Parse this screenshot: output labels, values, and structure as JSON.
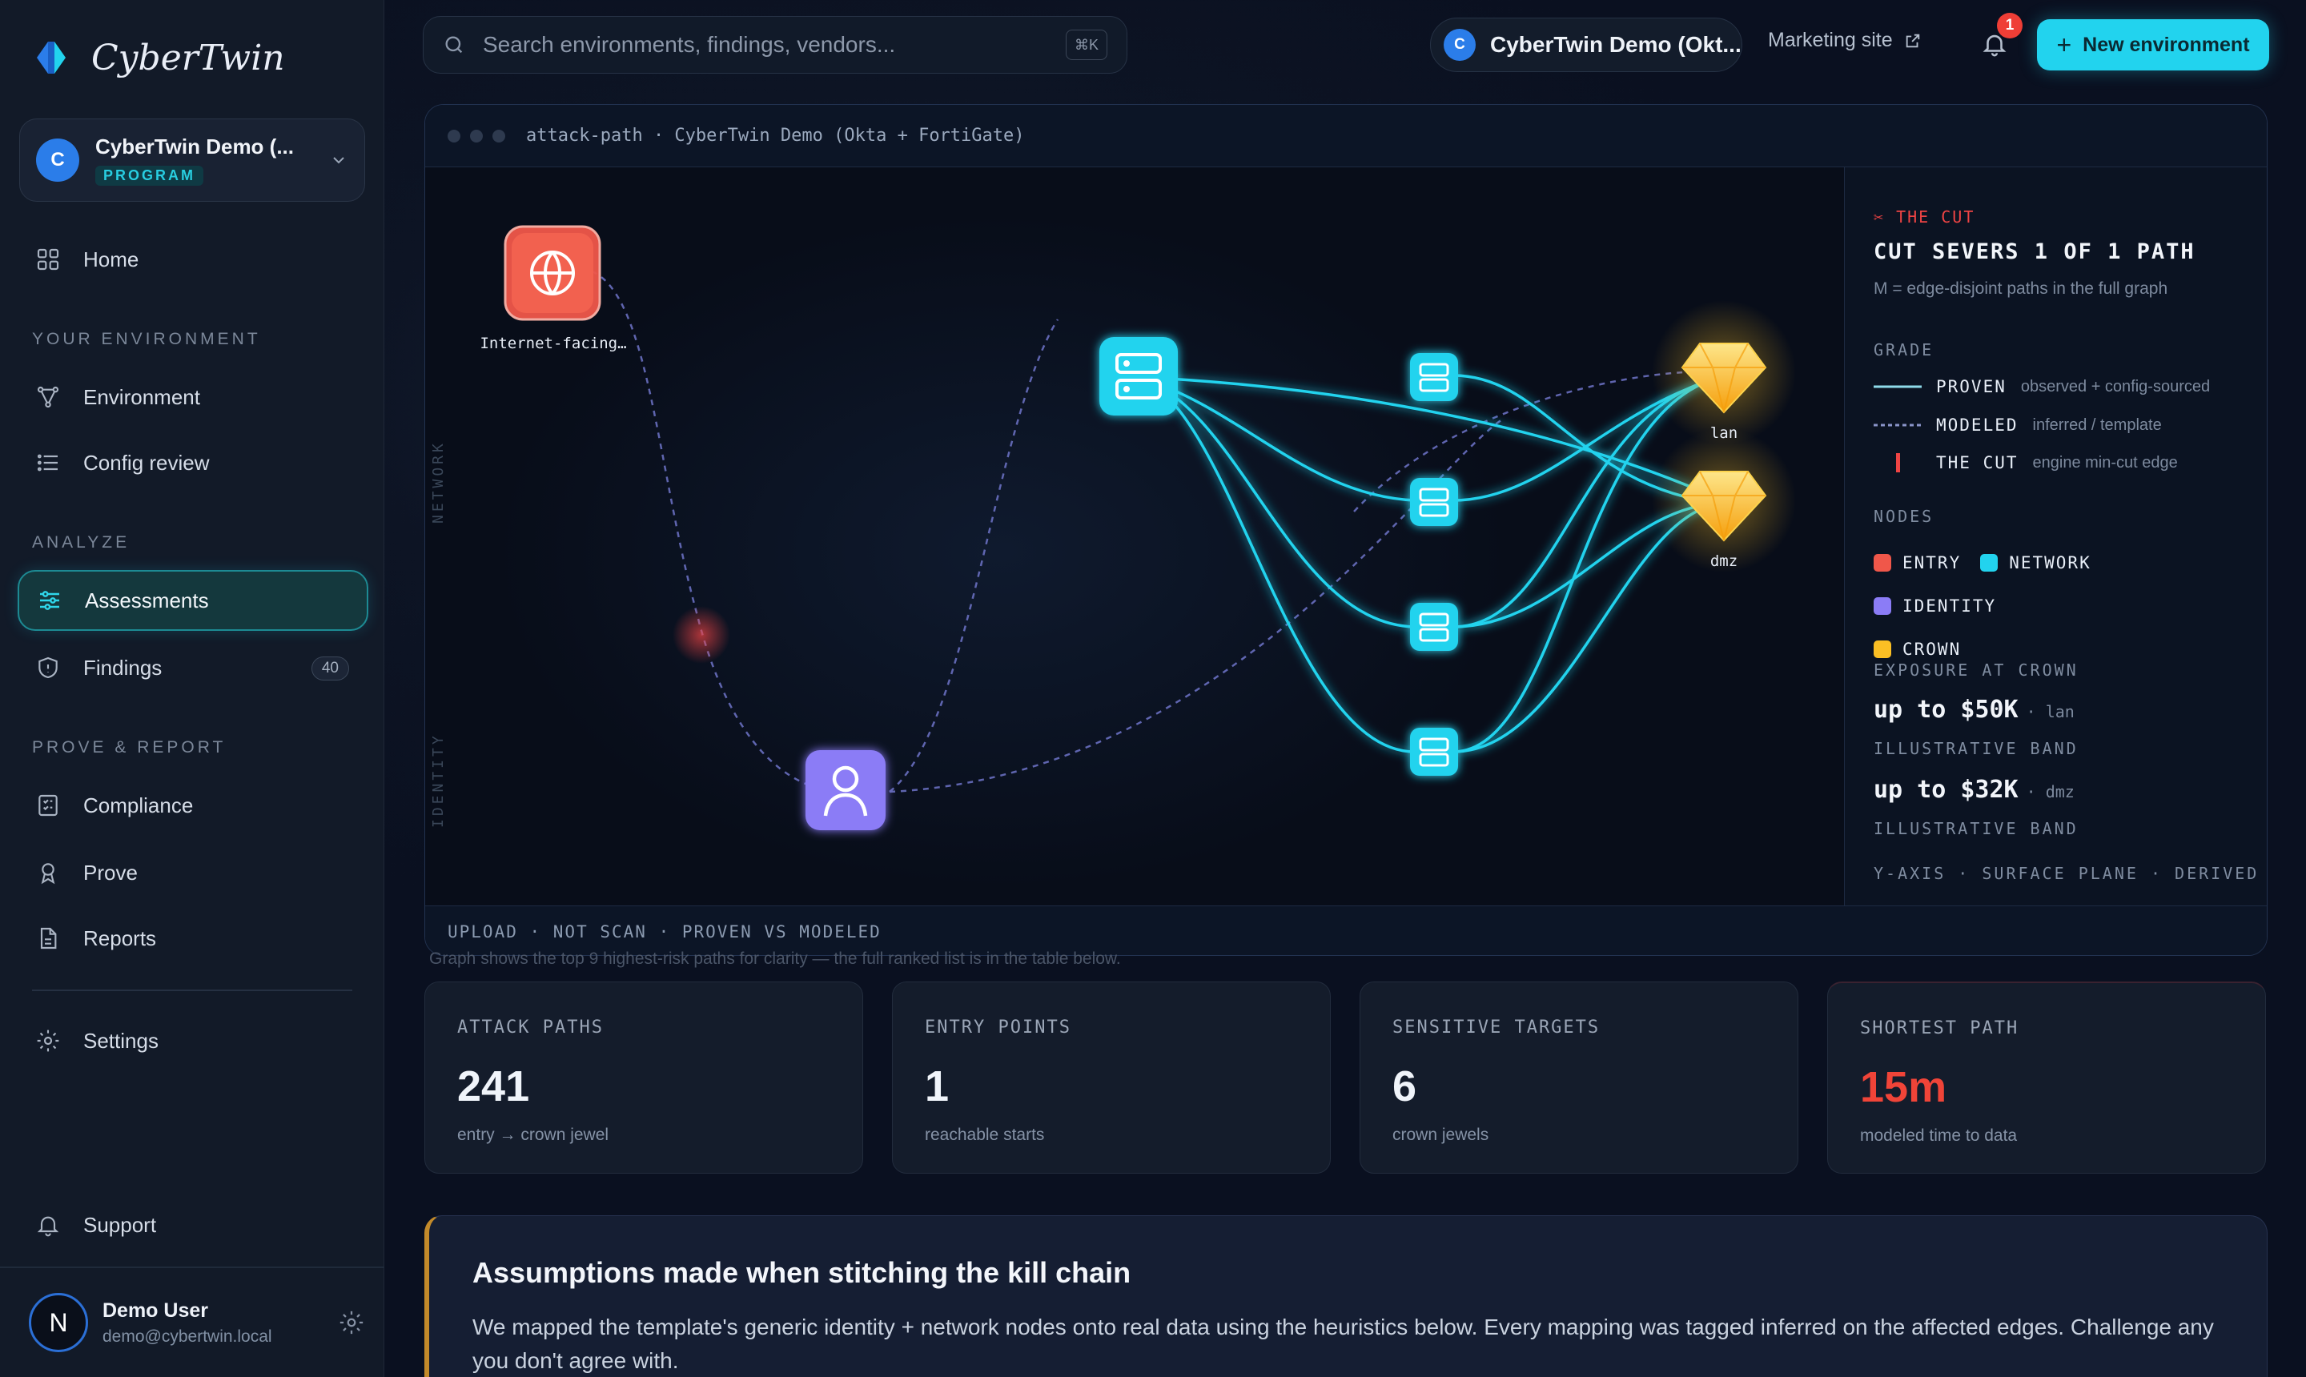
{
  "brand": {
    "name": "CyberTwin"
  },
  "program": {
    "avatar": "C",
    "name": "CyberTwin Demo (...",
    "badge": "PROGRAM"
  },
  "nav": {
    "home": "Home",
    "section_env": "YOUR ENVIRONMENT",
    "environment": "Environment",
    "config_review": "Config review",
    "section_analyze": "ANALYZE",
    "assessments": "Assessments",
    "findings": "Findings",
    "findings_count": "40",
    "section_prove": "PROVE & REPORT",
    "compliance": "Compliance",
    "prove": "Prove",
    "reports": "Reports",
    "settings": "Settings",
    "support": "Support"
  },
  "user": {
    "initial": "N",
    "name": "Demo User",
    "email": "demo@cybertwin.local"
  },
  "topbar": {
    "search_placeholder": "Search environments, findings, vendors...",
    "shortcut": "⌘K",
    "env_avatar": "C",
    "env_name": "CyberTwin Demo (Okt...",
    "marketing": "Marketing site",
    "notification_count": "1",
    "new_env": "New environment"
  },
  "graph": {
    "title": "attack-path · CyberTwin Demo (Okta + FortiGate)",
    "plane_network": "NETWORK",
    "plane_identity": "IDENTITY",
    "node_entry_label": "Internet-facing…",
    "crown_labels": [
      "lan",
      "dmz"
    ],
    "footer": "UPLOAD · NOT SCAN · PROVEN VS MODELED",
    "note": "Graph shows the top 9 highest-risk paths for clarity — the full ranked list is in the table below."
  },
  "legend": {
    "cut_tag": "✂ THE CUT",
    "headline": "CUT SEVERS 1 OF 1 PATH",
    "sub": "M = edge-disjoint paths in the full graph",
    "grade": "GRADE",
    "grades": [
      {
        "key": "PROVEN",
        "desc": "observed + config-sourced"
      },
      {
        "key": "MODELED",
        "desc": "inferred / template"
      },
      {
        "key": "THE CUT",
        "desc": "engine min-cut edge"
      }
    ],
    "nodes_title": "NODES",
    "nodes": [
      {
        "key": "ENTRY",
        "color": "#f0574a"
      },
      {
        "key": "NETWORK",
        "color": "#22d3ee"
      },
      {
        "key": "IDENTITY",
        "color": "#8b7cf6"
      },
      {
        "key": "CROWN",
        "color": "#fbbf24"
      }
    ],
    "exposure_title": "EXPOSURE AT CROWN",
    "exposures": [
      {
        "value": "up to $50K",
        "target": "· lan",
        "band": "ILLUSTRATIVE BAND"
      },
      {
        "value": "up to $32K",
        "target": "· dmz",
        "band": "ILLUSTRATIVE BAND"
      }
    ],
    "axis_note": "Y-AXIS · SURFACE PLANE · DERIVED"
  },
  "stats": [
    {
      "label": "ATTACK PATHS",
      "value": "241",
      "sub": "entry → crown jewel",
      "color": "#f0f4fa"
    },
    {
      "label": "ENTRY POINTS",
      "value": "1",
      "sub": "reachable starts",
      "color": "#f0f4fa"
    },
    {
      "label": "SENSITIVE TARGETS",
      "value": "6",
      "sub": "crown jewels",
      "color": "#f0f4fa"
    },
    {
      "label": "SHORTEST PATH",
      "value": "15m",
      "sub": "modeled time to data",
      "color": "#f04438"
    }
  ],
  "assumptions": {
    "title": "Assumptions made when stitching the kill chain",
    "body": "We mapped the template's generic identity + network nodes onto real data using the heuristics below. Every mapping was tagged inferred on the affected edges. Challenge any you don't agree with."
  },
  "colors": {
    "accent": "#22d3ee",
    "entry": "#f0574a",
    "identity": "#8b7cf6",
    "crown": "#fbbf24",
    "cut": "#ef4444"
  }
}
